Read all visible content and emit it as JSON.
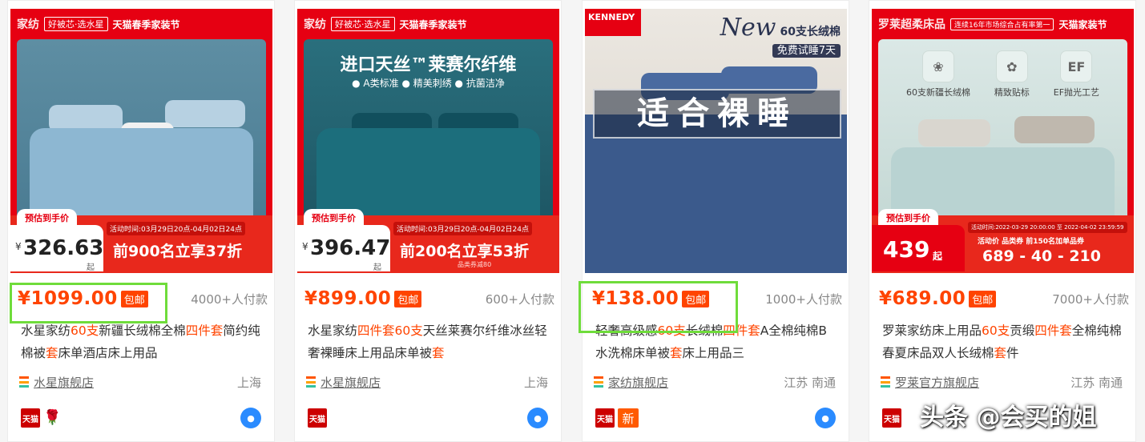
{
  "products": [
    {
      "banner": {
        "brand": "家纺",
        "tag": "好被芯·选水星",
        "event": "天猫春季家装节"
      },
      "promo": {
        "label": "预估到手价",
        "yen": "¥",
        "est_price": "326.63",
        "qi": "起",
        "time": "活动时间:03月29日20点-04月02日24点",
        "deal": "前900名立享37折",
        "sub": ""
      },
      "price": "¥1099.00",
      "baoyou": "包邮",
      "sales": "4000+人付款",
      "title_parts": [
        {
          "t": "水星家纺",
          "hl": false
        },
        {
          "t": "60支",
          "hl": true
        },
        {
          "t": "新疆长绒棉全棉",
          "hl": false
        },
        {
          "t": "四件套",
          "hl": true
        },
        {
          "t": "简约纯棉被",
          "hl": false
        },
        {
          "t": "套",
          "hl": true
        },
        {
          "t": "床单酒店床上用品",
          "hl": false
        }
      ],
      "shop": "水星旗舰店",
      "location": "上海",
      "badges": [
        "tmall",
        "rose"
      ],
      "colors": {
        "wall": "#5e8ea3",
        "bed": "#8db7d2",
        "pillow": "#b7d1e2",
        "pillow2": "#f1f1f1"
      }
    },
    {
      "banner": {
        "brand": "家纺",
        "tag": "好被芯·选水星",
        "event": "天猫春季家装节"
      },
      "headline": "进口天丝™莱赛尔纤维",
      "features": "● A类标准  ● 精美刺绣  ● 抗菌洁净",
      "promo": {
        "label": "预估到手价",
        "yen": "¥",
        "est_price": "396.47",
        "qi": "起",
        "time": "活动时间:03月29日20点-04月02日24点",
        "deal": "前200名立享53折",
        "sub": "品类券减80"
      },
      "price": "¥899.00",
      "baoyou": "包邮",
      "sales": "600+人付款",
      "title_parts": [
        {
          "t": "水星家纺",
          "hl": false
        },
        {
          "t": "四件套",
          "hl": true
        },
        {
          "t": "60支",
          "hl": true
        },
        {
          "t": "天丝莱赛尔纤维冰丝轻奢裸睡床上用品床单被",
          "hl": false
        },
        {
          "t": "套",
          "hl": true
        }
      ],
      "shop": "水星旗舰店",
      "location": "上海",
      "badges": [
        "tmall"
      ],
      "colors": {
        "wall": "#2a6f7d",
        "bed": "#1c6e7c",
        "pillow": "#114f5d",
        "pillow2": "#8fe0d6"
      }
    },
    {
      "banner": {
        "brand": "KENNEDY"
      },
      "newtag": {
        "n1": "New",
        "n1b": "60支长绒棉",
        "n2": "免费试睡7天"
      },
      "bigtext": "适合裸睡",
      "price": "¥138.00",
      "baoyou": "包邮",
      "sales": "1000+人付款",
      "title_parts": [
        {
          "t": "轻奢高级感",
          "hl": false
        },
        {
          "t": "60支",
          "hl": true
        },
        {
          "t": "长绒棉",
          "hl": false
        },
        {
          "t": "四件套",
          "hl": true
        },
        {
          "t": "A全棉纯棉B水洗棉床单被",
          "hl": false
        },
        {
          "t": "套",
          "hl": true
        },
        {
          "t": "床上用品三",
          "hl": false
        }
      ],
      "shop": "家纺旗舰店",
      "location": "江苏 南通",
      "badges": [
        "tmall",
        "xin"
      ],
      "badge_xin": "新",
      "colors": {
        "wall": "#e7e3de",
        "bed": "#3b5a8c",
        "pillow": "#4a6aa0",
        "pillow2": "#d9d4cc"
      }
    },
    {
      "banner": {
        "brand": "罗莱超柔床品",
        "tag": "连续16年市场综合占有率第一",
        "event": "天猫家装节"
      },
      "icons": [
        {
          "label": "60支新疆长绒棉",
          "glyph": "❀"
        },
        {
          "label": "精致贴标",
          "glyph": "✿"
        },
        {
          "label": "EF抛光工艺",
          "glyph": "EF"
        }
      ],
      "promo": {
        "label": "预估到手价",
        "yen": "",
        "est_price": "439",
        "qi": "起",
        "time": "活动时间:2022-03-29 20:00:00 至 2022-04-02 23:59:59",
        "deal": "689 - 40 - 210",
        "deal_labels": "活动价   品类券   前150名加单品券",
        "sub": ""
      },
      "price": "¥689.00",
      "baoyou": "包邮",
      "sales": "7000+人付款",
      "title_parts": [
        {
          "t": "罗莱家纺床上用品",
          "hl": false
        },
        {
          "t": "60支",
          "hl": true
        },
        {
          "t": "贡缎",
          "hl": false
        },
        {
          "t": "四件套",
          "hl": true
        },
        {
          "t": "全棉纯棉春夏床品双人长绒棉",
          "hl": false
        },
        {
          "t": "套",
          "hl": true
        },
        {
          "t": "件",
          "hl": false
        }
      ],
      "shop": "罗莱官方旗舰店",
      "location": "江苏 南通",
      "badges": [
        "tmall"
      ],
      "colors": {
        "wall": "#c4d8d4",
        "bed": "#b9d3d2",
        "pillow": "#d9d6cf",
        "pillow2": "#bfb8ae"
      }
    }
  ],
  "watermark": "头条 @会买的姐",
  "accent": "#ff4400",
  "highlight_color": "#6fdc3b"
}
